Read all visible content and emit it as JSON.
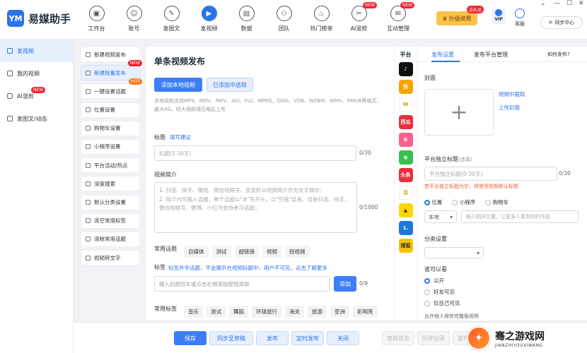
{
  "app": {
    "name": "易媒助手",
    "logo_glyph": "YM"
  },
  "window_controls": {
    "menu": "⌄",
    "minimize": "—",
    "maximize": "☐",
    "close": "✕"
  },
  "nav": [
    {
      "label": "工作台",
      "icon": "dashboard-icon",
      "glyph": "▣"
    },
    {
      "label": "账号",
      "icon": "account-icon",
      "glyph": "☺"
    },
    {
      "label": "发图文",
      "icon": "post-image-text-icon",
      "glyph": "✎"
    },
    {
      "label": "发视频",
      "icon": "post-video-icon",
      "glyph": "▶"
    },
    {
      "label": "数据",
      "icon": "data-icon",
      "glyph": "▤"
    },
    {
      "label": "团队",
      "icon": "team-icon",
      "glyph": "⚇"
    },
    {
      "label": "热门榜单",
      "icon": "hot-list-icon",
      "glyph": "♨"
    },
    {
      "label": "AI混剪",
      "icon": "ai-remix-icon",
      "glyph": "✂",
      "badge": "NEW"
    },
    {
      "label": "互动管理",
      "icon": "interaction-icon",
      "glyph": "✉",
      "badge": "NEW"
    }
  ],
  "header_right": {
    "upgrade_label": "升级续费",
    "upgrade_badge": "送礼品",
    "avatar_text": "VIP",
    "service_label": "客服",
    "sync_label": "同步中心"
  },
  "sidebar": [
    {
      "label": "发视频",
      "icon": "video-icon",
      "active": true
    },
    {
      "label": "我的视频",
      "icon": "my-videos-icon"
    },
    {
      "label": "AI混剪",
      "icon": "ai-remix-icon",
      "badge": "NEW"
    },
    {
      "label": "发图文/动态",
      "icon": "post-image-text-icon"
    }
  ],
  "submenu": [
    {
      "label": "新建视频发布",
      "icon": "new-video-icon"
    },
    {
      "label": "新建批量发布",
      "icon": "batch-publish-icon",
      "active": true,
      "badge": "NEW",
      "badge_color": "#f5222d"
    },
    {
      "label": "一键设置话题",
      "icon": "hashtag-icon",
      "badge": "HOT",
      "badge_color": "#ff7a18"
    },
    {
      "label": "位置设置",
      "icon": "location-icon"
    },
    {
      "label": "购物车设置",
      "icon": "cart-icon"
    },
    {
      "label": "小程序设置",
      "icon": "mini-program-icon"
    },
    {
      "label": "平台活动/热点",
      "icon": "activity-icon"
    },
    {
      "label": "深度搜索",
      "icon": "deep-search-icon"
    },
    {
      "label": "默认分类设置",
      "icon": "category-icon"
    },
    {
      "label": "清空常用标签",
      "icon": "clear-tags-icon"
    },
    {
      "label": "清除常用话题",
      "icon": "clear-topics-icon"
    },
    {
      "label": "视频转文字",
      "icon": "video-to-text-icon"
    }
  ],
  "main": {
    "title": "单条视频发布",
    "add_local_label": "添加本地视频",
    "add_selected_label": "已添加中选取",
    "format_hint": "本地视频支持MP4、MOV、MKV、AVI、FLV、MPEG、OGG、VOB、WEBM、WMV、RMVB等格式，最大4G，较大视频请压缩后上传",
    "title_label": "标题",
    "title_fill_tip": "填写建议",
    "title_placeholder": "标题(5-30字)",
    "title_counter": "0/30",
    "desc_label": "视频简介",
    "desc_placeholder_line1": "1. 抖音、快手、微视、微信视频号、皮皮虾以视频简介作为文字展示；",
    "desc_placeholder_line2": "2. 简介内可输入话题，单个话题以\"#\"号开头，以\"空格\"结束。目前抖音、快手、微信视频号、微博、小红书支持参与话题；",
    "desc_counter": "0/1000",
    "common_topics_label": "常用话题",
    "common_topics": [
      "自媒体",
      "测试",
      "超链接",
      "视频",
      "短视频"
    ],
    "tags_label": "标签",
    "tags_note": "标签并非话题，不会展示在视频标题中，用户不可见，点击了解更多",
    "tags_placeholder": "输入后按回车或点击右侧添加按钮添加",
    "tags_add_label": "添加",
    "tags_counter": "0/9",
    "common_tags_label": "常用标签",
    "common_tags": [
      "音乐",
      "测试",
      "舞蹈",
      "环球旅行",
      "海关",
      "旅游",
      "亚洲",
      "彩明亮"
    ]
  },
  "platforms": {
    "header": "平台",
    "items": [
      {
        "name": "抖音",
        "icon": "douyin-icon",
        "color": "#111111",
        "glyph": "♪"
      },
      {
        "name": "快手",
        "icon": "kuaishou-icon",
        "color": "#f7a400",
        "glyph": "快"
      },
      {
        "name": "微视",
        "icon": "weishi-icon",
        "color": "#ffffff",
        "glyph": "W"
      },
      {
        "name": "西瓜视频",
        "icon": "xigua-icon",
        "color": "#e8303b",
        "glyph": "西瓜"
      },
      {
        "name": "哔哩哔哩",
        "icon": "bilibili-icon",
        "color": "#fb5f8e",
        "glyph": "B"
      },
      {
        "name": "微信视频号",
        "icon": "wechat-channels-icon",
        "color": "#34c04a",
        "glyph": "◉"
      },
      {
        "name": "头条",
        "icon": "toutiao-icon",
        "color": "#e8303b",
        "glyph": "头条"
      },
      {
        "name": "百家号",
        "icon": "baijiahao-icon",
        "color": "#ffffff",
        "glyph": "百"
      },
      {
        "name": "快看",
        "icon": "kuaikan-icon",
        "color": "#ffd400",
        "glyph": "▲"
      },
      {
        "name": "一点号",
        "icon": "yidian-icon",
        "color": "#1a7ad9",
        "glyph": "1."
      },
      {
        "name": "搜狐",
        "icon": "sohu-icon",
        "color": "#f5c400",
        "glyph": "搜狐"
      }
    ]
  },
  "settings": {
    "tab_publish": "发布设置",
    "tab_platform_manage": "发布平台管理",
    "how_publish_link": "如何发布?",
    "cover_label": "封面",
    "cover_from_video": "视频中截取",
    "cover_upload": "上传封面",
    "platform_title_label": "平台独立标题",
    "platform_title_optional": "(选填)",
    "platform_title_placeholder": "平台独立标题(0-30字)",
    "platform_title_counter": "0/30",
    "platform_title_warning": "若平台独立标题为空，将使用视频默认标题",
    "radio_location": "位置",
    "radio_miniprogram": "小程序",
    "radio_cart": "购物车",
    "location_select": "本地",
    "location_input_placeholder": "输入相关位置，让更多人看到你的作品",
    "category_label": "分类设置",
    "visibility_label": "谁可以看",
    "visibility_options": [
      "公开",
      "好友可见",
      "仅自己可见"
    ],
    "allow_save_label": "允许他人保存完整版视频"
  },
  "bottom_bar": {
    "save": "保存",
    "sync_draft": "同步至草稿",
    "publish": "发布",
    "scheduled": "定时发布",
    "close": "关闭",
    "review_status": "审核状态",
    "sync_records": "同步记录",
    "publish_records": "发布记录"
  },
  "watermark": {
    "title": "骞之游戏网",
    "subtitle": "JIANZHIYOUXIWANG"
  }
}
